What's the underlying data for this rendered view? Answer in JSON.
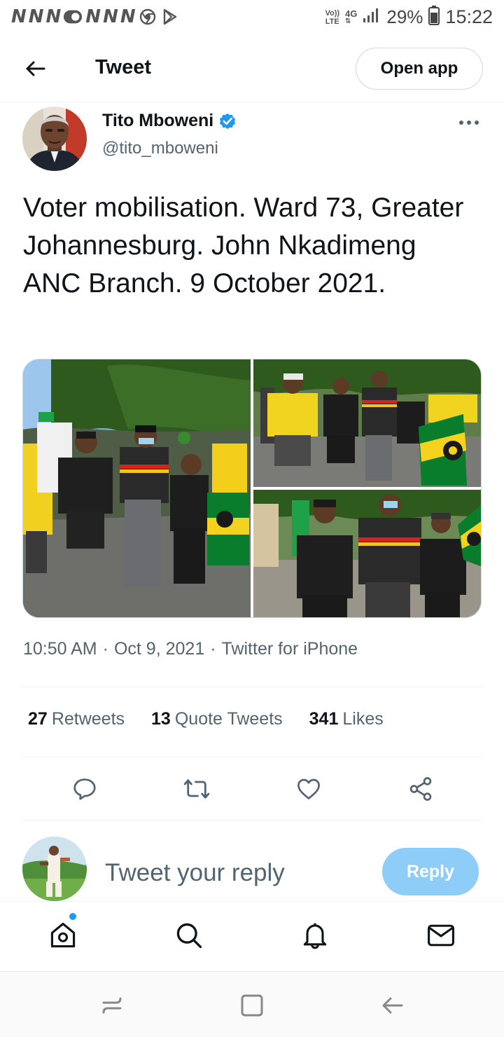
{
  "status_bar": {
    "notification_icons": [
      "N",
      "N",
      "N",
      "NN",
      "N",
      "N",
      "N"
    ],
    "extra_icons": [
      "chrome-icon",
      "play-store-icon"
    ],
    "volte_top": "Vo))",
    "volte_bottom": "LTE",
    "network": "4G",
    "battery": "29%",
    "time": "15:22"
  },
  "header": {
    "title": "Tweet",
    "open_app_label": "Open app"
  },
  "tweet": {
    "author_name": "Tito Mboweni",
    "author_handle": "@tito_mboweni",
    "verified": true,
    "text": "Voter mobilisation. Ward 73, Greater Johannesburg. John Nkadimeng ANC Branch. 9 October 2021.",
    "media_count": 3,
    "time": "10:50 AM",
    "date": "Oct 9, 2021",
    "source": "Twitter for iPhone",
    "separator": "·"
  },
  "stats": [
    {
      "value": "27",
      "label": "Retweets"
    },
    {
      "value": "13",
      "label": "Quote Tweets"
    },
    {
      "value": "341",
      "label": "Likes"
    }
  ],
  "actions": [
    "reply-icon",
    "retweet-icon",
    "like-icon",
    "share-icon"
  ],
  "reply": {
    "placeholder": "Tweet your reply",
    "button_label": "Reply"
  },
  "bottom_tabs": [
    "home-icon",
    "search-icon",
    "notifications-icon",
    "messages-icon"
  ],
  "colors": {
    "accent": "#1d9bf0",
    "reply_button": "#8ecdf8",
    "secondary_text": "#536471",
    "primary_text": "#0f1419",
    "anc_green": "#0a7d2c",
    "anc_yellow": "#f4d21e"
  }
}
